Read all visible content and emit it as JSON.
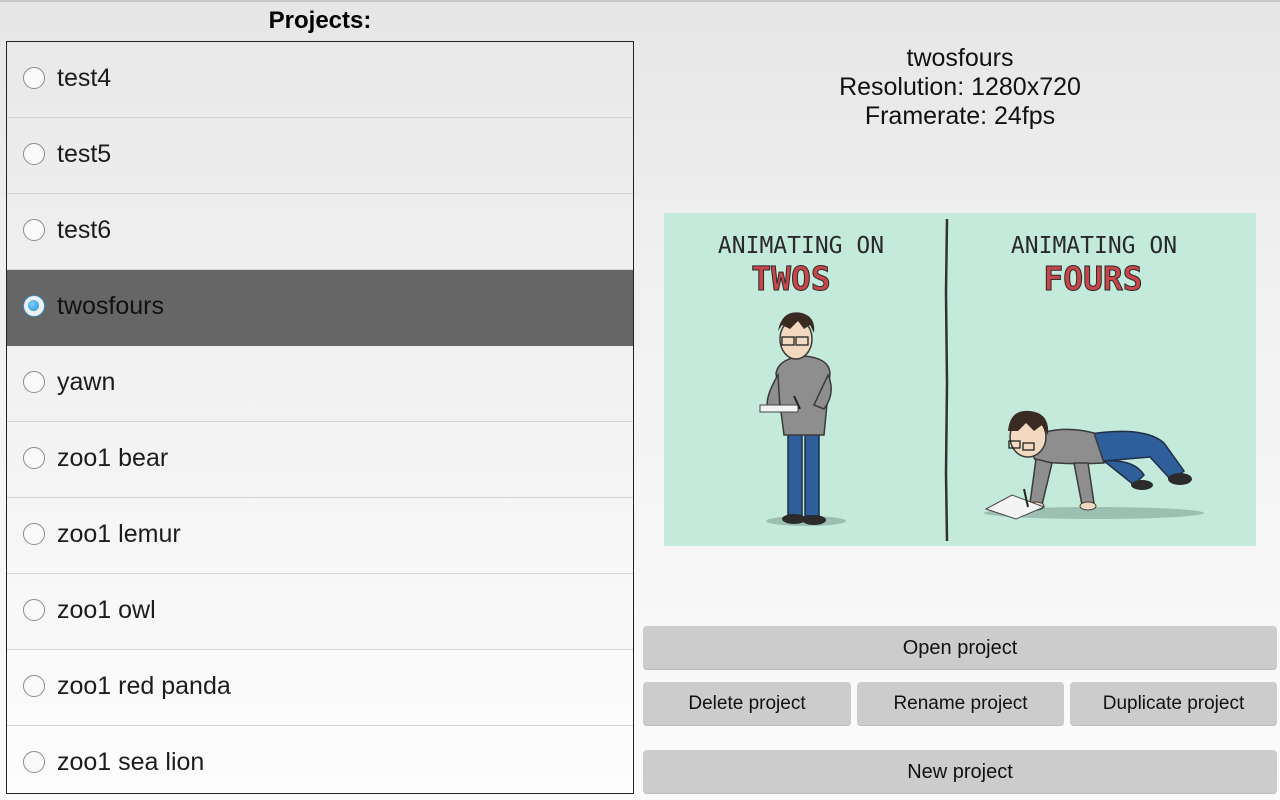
{
  "heading": "Projects:",
  "projects": [
    {
      "name": "test4",
      "selected": false
    },
    {
      "name": "test5",
      "selected": false
    },
    {
      "name": "test6",
      "selected": false
    },
    {
      "name": "twosfours",
      "selected": true
    },
    {
      "name": "yawn",
      "selected": false
    },
    {
      "name": "zoo1 bear",
      "selected": false
    },
    {
      "name": "zoo1 lemur",
      "selected": false
    },
    {
      "name": "zoo1 owl",
      "selected": false
    },
    {
      "name": "zoo1 red panda",
      "selected": false
    },
    {
      "name": "zoo1 sea lion",
      "selected": false
    }
  ],
  "details": {
    "name": "twosfours",
    "resolution": "Resolution: 1280x720",
    "framerate": "Framerate: 24fps"
  },
  "preview": {
    "left_title": "ANIMATING ON",
    "left_emph": "TWOS",
    "right_title": "ANIMATING ON",
    "right_emph": "FOURS",
    "background": "#c3eadb",
    "emph_color": "#c9454a"
  },
  "buttons": {
    "open": "Open project",
    "delete": "Delete project",
    "rename": "Rename project",
    "duplicate": "Duplicate project",
    "new": "New project"
  },
  "colors": {
    "selected_row": "#666666",
    "button_bg": "#cccccc",
    "radio_accent": "#1f8fd6"
  }
}
